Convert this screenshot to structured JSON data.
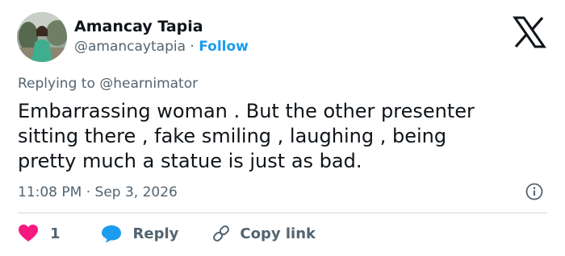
{
  "author": {
    "name": "Amancay Tapia",
    "handle": "@amancaytapia",
    "separator": "·",
    "follow_label": "Follow"
  },
  "reply_to": "Replying to @hearnimator",
  "tweet_text": "Embarrassing woman . But the other presenter\nsitting there ,  fake smiling , laughing , being\npretty much a statue is just as bad.",
  "timestamp": "11:08 PM · Sep 3, 2026",
  "actions": {
    "like_count": "1",
    "reply_label": "Reply",
    "copy_label": "Copy link"
  },
  "icons": {
    "x_logo": "x-logo-icon",
    "info": "info-icon",
    "heart": "heart-icon",
    "reply": "speech-bubble-icon",
    "copy": "link-icon"
  },
  "colors": {
    "text": "#0f1419",
    "secondary": "#536471",
    "accent": "#1d9bf0",
    "like": "#f91880",
    "divider": "#cfd9de"
  }
}
